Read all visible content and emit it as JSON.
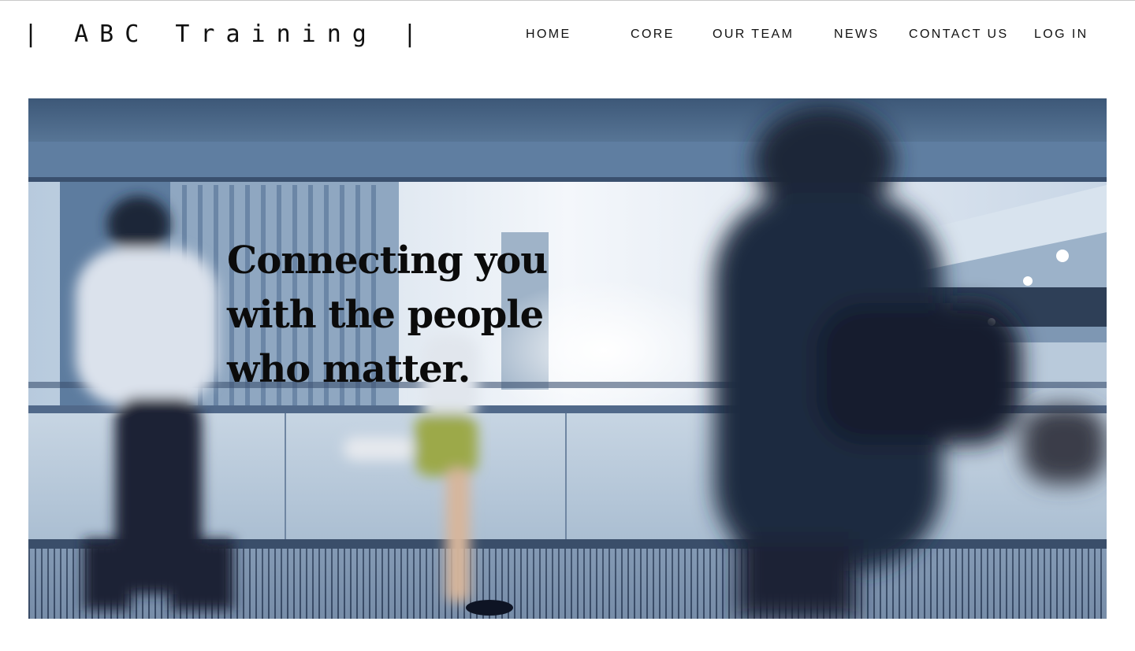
{
  "brand": {
    "logo_text": "| ABC Training |"
  },
  "nav": {
    "home": "HOME",
    "core": "CORE",
    "our_team": "OUR TEAM",
    "news": "NEWS",
    "contact_us": "CONTACT US",
    "log_in": "LOG IN"
  },
  "hero": {
    "headline_lines": [
      "Connecting you",
      "with the people",
      "who matter."
    ],
    "image": "blurred-commuters-walkway-photo"
  },
  "colors": {
    "text": "#111111",
    "hero_sky": "#eef3f8",
    "hero_blue": "#6d8dae",
    "hero_dark": "#1f2b3f"
  }
}
